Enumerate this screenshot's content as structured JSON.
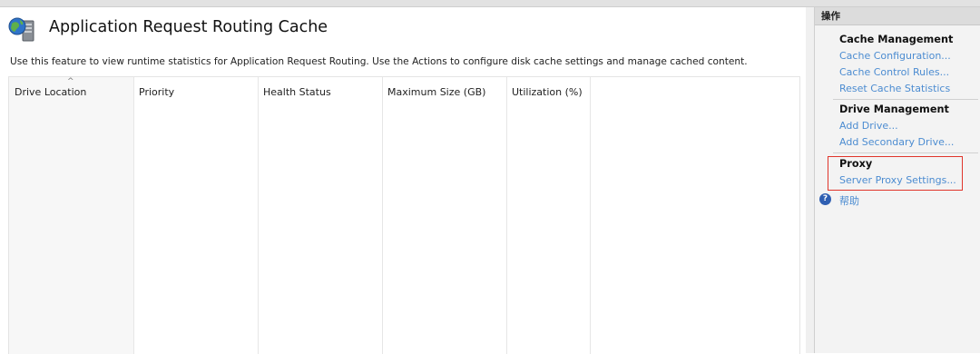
{
  "main": {
    "title": "Application Request Routing Cache",
    "description": "Use this feature to view runtime statistics for Application Request Routing.  Use the Actions to configure disk cache settings and manage cached content.",
    "columns": [
      "Drive Location",
      "Priority",
      "Health Status",
      "Maximum Size (GB)",
      "Utilization (%)"
    ],
    "rows": []
  },
  "actions": {
    "header": "操作",
    "cache_management": {
      "title": "Cache Management",
      "links": [
        "Cache Configuration...",
        "Cache Control Rules...",
        "Reset Cache Statistics"
      ]
    },
    "drive_management": {
      "title": "Drive Management",
      "links": [
        "Add Drive...",
        "Add Secondary Drive..."
      ]
    },
    "proxy": {
      "title": "Proxy",
      "links": [
        "Server Proxy Settings..."
      ]
    },
    "help": "帮助"
  },
  "icons": {
    "feature": "globe-server-icon",
    "help": "help-icon",
    "sort": "sort-ascending-icon"
  },
  "colors": {
    "link": "#4c8cd1",
    "highlight": "#e0352b"
  }
}
